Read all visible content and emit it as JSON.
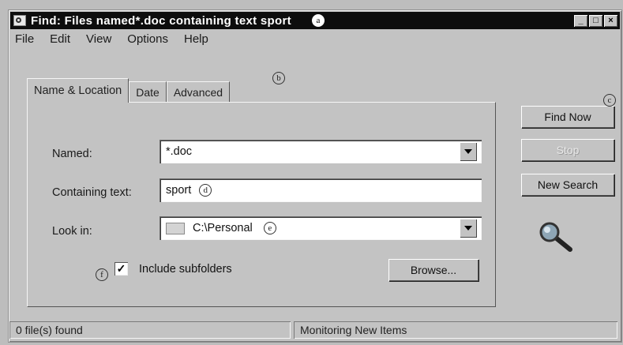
{
  "window": {
    "title": "Find: Files named*.doc containing text sport",
    "callouts": {
      "title": "a",
      "tabs": "b",
      "find_now": "c",
      "containing": "d",
      "look_in": "e",
      "subfolders": "f"
    },
    "controls": {
      "minimize": "_",
      "maximize": "□",
      "close": "×"
    }
  },
  "menu": [
    "File",
    "Edit",
    "View",
    "Options",
    "Help"
  ],
  "tabs": [
    {
      "label": "Name & Location",
      "active": true
    },
    {
      "label": "Date",
      "active": false
    },
    {
      "label": "Advanced",
      "active": false
    }
  ],
  "form": {
    "named_label": "Named:",
    "named_value": "*.doc",
    "containing_label": "Containing text:",
    "containing_value": "sport",
    "lookin_label": "Look in:",
    "lookin_value": "C:\\Personal",
    "subfolders_label": "Include subfolders",
    "subfolders_checked": "✓",
    "browse_label": "Browse..."
  },
  "buttons": {
    "find_now": "Find Now",
    "stop": "Stop",
    "new_search": "New Search"
  },
  "status": {
    "left": "0 file(s) found",
    "right": "Monitoring New Items"
  },
  "icons": {
    "app": "find-app-icon",
    "magnifier": "magnifier-icon",
    "folder": "folder-icon"
  }
}
